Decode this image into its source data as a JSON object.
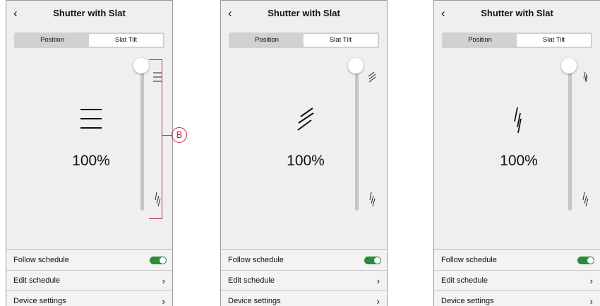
{
  "header": {
    "back_icon": "chevron-left-icon",
    "back_glyph": "‹",
    "title": "Shutter with Slat"
  },
  "tabs": {
    "position": "Position",
    "slat_tilt": "Slat Tilt",
    "selected": "Slat Tilt"
  },
  "screens": [
    {
      "slat_state": "horizontal",
      "percent": "100%",
      "slider_value": 1.0
    },
    {
      "slat_state": "tilted",
      "percent": "100%",
      "slider_value": 1.0
    },
    {
      "slat_state": "vertical",
      "percent": "100%",
      "slider_value": 1.0
    }
  ],
  "settings": {
    "follow_schedule": {
      "label": "Follow schedule",
      "on": true
    },
    "edit_schedule": "Edit schedule",
    "device_settings": "Device settings",
    "chevron_glyph": "›"
  },
  "annotation": {
    "label": "B",
    "color": "#c8264a"
  },
  "colors": {
    "toggle_on": "#2a8c3a",
    "background": "#eef0ef"
  }
}
